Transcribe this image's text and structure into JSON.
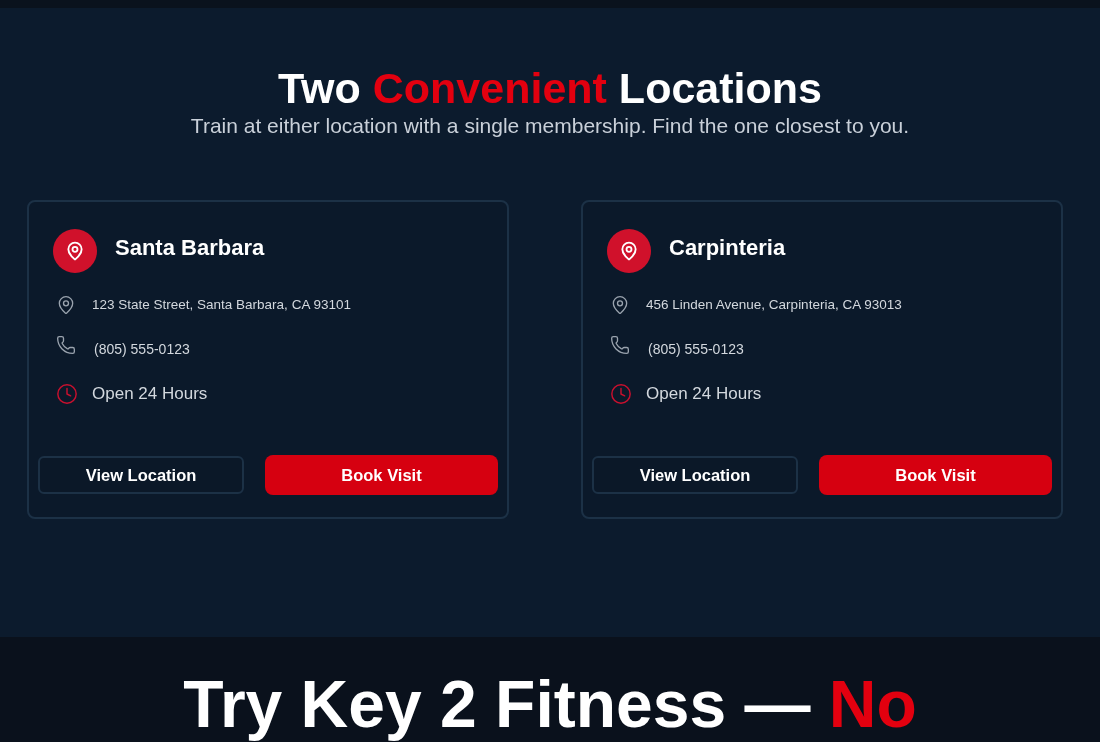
{
  "header": {
    "title_parts": [
      {
        "text": "Two ",
        "highlight": false
      },
      {
        "text": "Convenient",
        "highlight": true
      },
      {
        "text": " Locations",
        "highlight": false
      }
    ],
    "subtitle": "Train at either location with a single membership. Find the one closest to you."
  },
  "locations": [
    {
      "name": "Santa Barbara",
      "address": "123 State Street, Santa Barbara, CA 93101",
      "phone": "(805) 555-0123",
      "hours": "Open 24 Hours",
      "buttons": [
        {
          "label": "View Location",
          "kind": "outline"
        },
        {
          "label": "Book Visit",
          "kind": "primary"
        }
      ]
    },
    {
      "name": "Carpinteria",
      "address": "456 Linden Avenue, Carpinteria, CA 93013",
      "phone": "(805) 555-0123",
      "hours": "Open 24 Hours",
      "buttons": [
        {
          "label": "View Location",
          "kind": "outline"
        },
        {
          "label": "Book Visit",
          "kind": "primary"
        }
      ]
    }
  ],
  "cta": {
    "title_parts": [
      {
        "text": "Try Key 2 Fitness — ",
        "highlight": false
      },
      {
        "text": "No",
        "highlight": true
      }
    ]
  }
}
